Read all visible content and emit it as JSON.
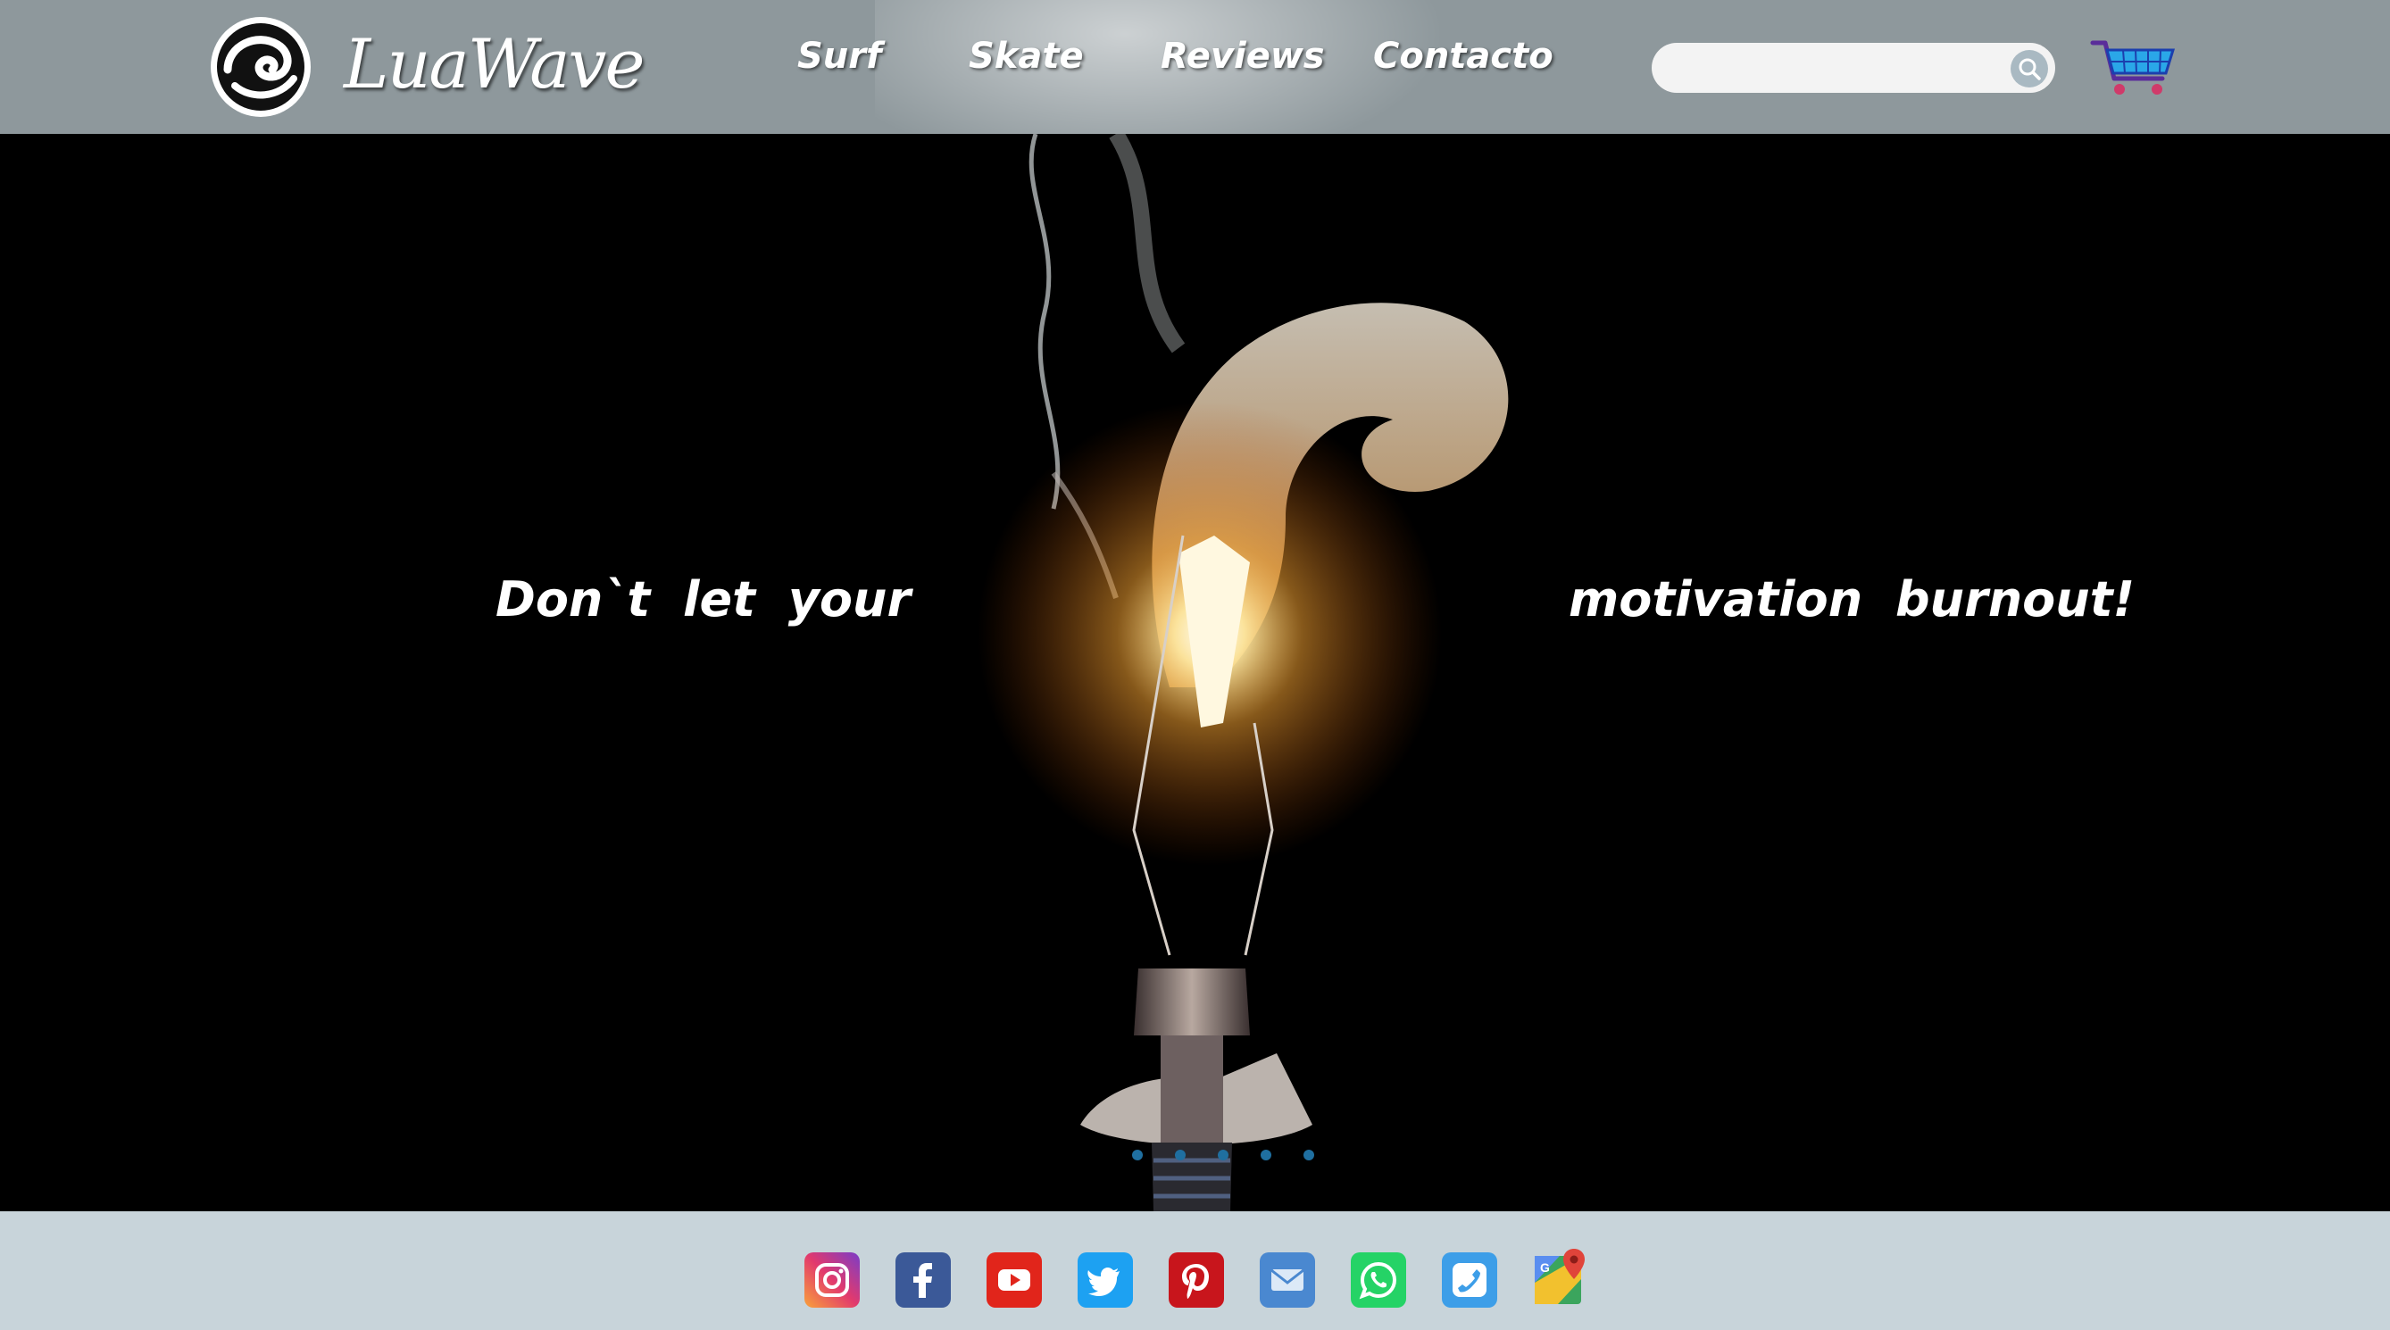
{
  "brand": {
    "name": "LuaWave",
    "logo_icon": "wave-logo-icon"
  },
  "nav": {
    "items": [
      {
        "label": "Surf"
      },
      {
        "label": "Skate"
      },
      {
        "label": "Reviews"
      },
      {
        "label": "Contacto"
      }
    ]
  },
  "search": {
    "value": "",
    "placeholder": "",
    "icon": "search-icon"
  },
  "cart": {
    "icon": "shopping-cart-icon"
  },
  "hero": {
    "text_left": "Don`t let your",
    "text_right": "motivation burnout!",
    "slide_count": 5
  },
  "footer": {
    "social_icons": [
      "instagram-icon",
      "facebook-icon",
      "youtube-icon",
      "twitter-icon",
      "pinterest-icon",
      "email-icon",
      "whatsapp-icon",
      "phone-icon",
      "google-maps-icon"
    ]
  },
  "colors": {
    "header_bg": "#8e989c",
    "footer_bg": "#c8d4da",
    "hero_bg": "#000000",
    "text": "#ffffff"
  }
}
